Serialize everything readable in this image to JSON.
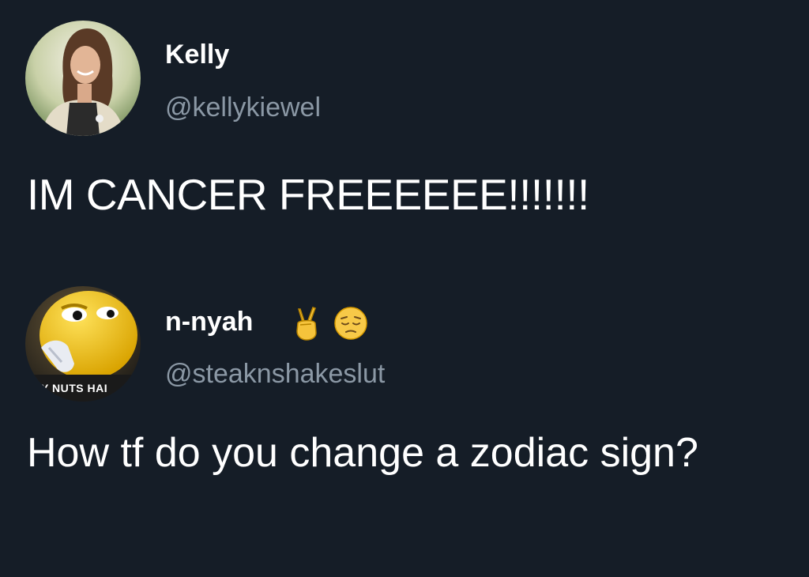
{
  "tweets": [
    {
      "user": {
        "display_name": "Kelly",
        "handle": "@kellykiewel",
        "avatar_icon": "profile-photo-woman"
      },
      "text": "IM CANCER FREEEEEE!!!!!!!"
    },
    {
      "user": {
        "display_name": "n-nyah",
        "handle": "@steaknshakeslut",
        "avatar_icon": "yellow-mascot-cartoon",
        "avatar_caption": "Y NUTS HAI",
        "name_emojis": [
          "victory-hand-emoji",
          "pensive-face-emoji"
        ]
      },
      "text": "How tf do you change a zodiac sign?"
    }
  ],
  "colors": {
    "background": "#151d27",
    "text_primary": "#ffffff",
    "text_secondary": "#8b98a5"
  }
}
